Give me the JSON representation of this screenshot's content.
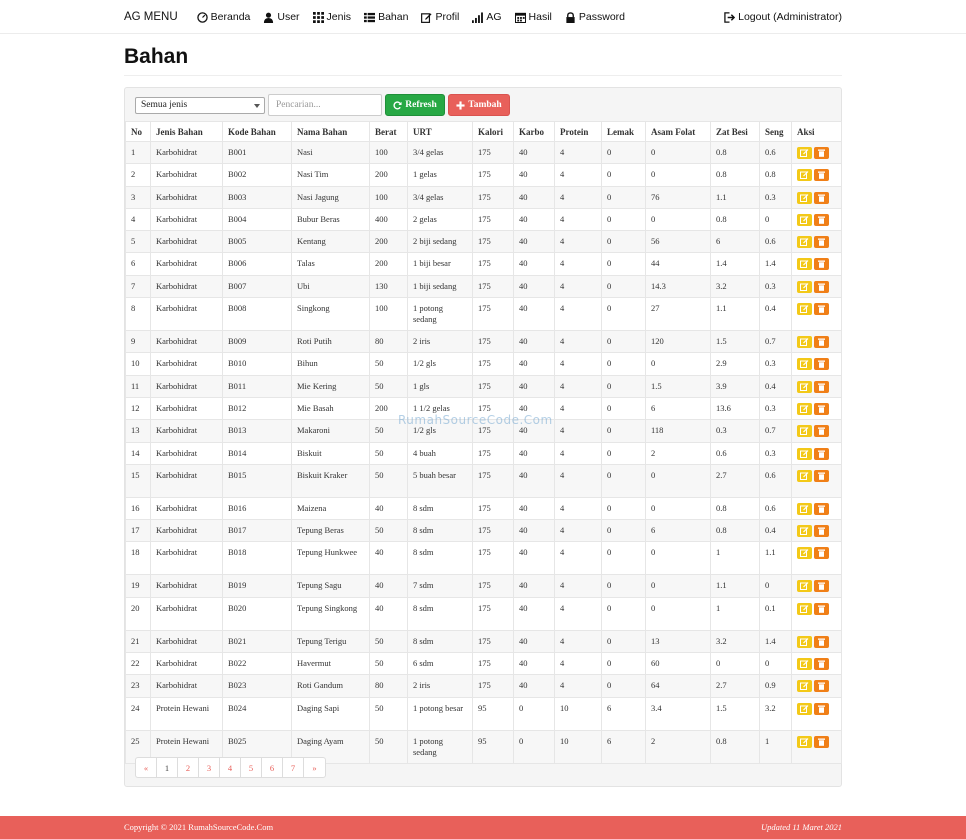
{
  "nav": {
    "brand": "AG MENU",
    "items": [
      {
        "label": "Beranda",
        "icon": "dashboard-icon"
      },
      {
        "label": "User",
        "icon": "user-icon"
      },
      {
        "label": "Jenis",
        "icon": "grid-icon"
      },
      {
        "label": "Bahan",
        "icon": "list-icon"
      },
      {
        "label": "Profil",
        "icon": "edit-icon"
      },
      {
        "label": "AG",
        "icon": "signal-icon"
      },
      {
        "label": "Hasil",
        "icon": "calendar-icon"
      },
      {
        "label": "Password",
        "icon": "lock-icon"
      }
    ],
    "logout": "Logout (Administrator)"
  },
  "page": {
    "title": "Bahan"
  },
  "toolbar": {
    "filter_value": "Semua jenis",
    "search_placeholder": "Pencarian...",
    "refresh_label": "Refresh",
    "add_label": "Tambah"
  },
  "table": {
    "headers": [
      "No",
      "Jenis Bahan",
      "Kode Bahan",
      "Nama Bahan",
      "Berat",
      "URT",
      "Kalori",
      "Karbo",
      "Protein",
      "Lemak",
      "Asam Folat",
      "Zat Besi",
      "Seng",
      "Aksi"
    ],
    "rows": [
      [
        "1",
        "Karbohidrat",
        "B001",
        "Nasi",
        "100",
        "3/4 gelas",
        "175",
        "40",
        "4",
        "0",
        "0",
        "0.8",
        "0.6"
      ],
      [
        "2",
        "Karbohidrat",
        "B002",
        "Nasi Tim",
        "200",
        "1 gelas",
        "175",
        "40",
        "4",
        "0",
        "0",
        "0.8",
        "0.8"
      ],
      [
        "3",
        "Karbohidrat",
        "B003",
        "Nasi Jagung",
        "100",
        "3/4 gelas",
        "175",
        "40",
        "4",
        "0",
        "76",
        "1.1",
        "0.3"
      ],
      [
        "4",
        "Karbohidrat",
        "B004",
        "Bubur Beras",
        "400",
        "2 gelas",
        "175",
        "40",
        "4",
        "0",
        "0",
        "0.8",
        "0"
      ],
      [
        "5",
        "Karbohidrat",
        "B005",
        "Kentang",
        "200",
        "2 biji sedang",
        "175",
        "40",
        "4",
        "0",
        "56",
        "6",
        "0.6"
      ],
      [
        "6",
        "Karbohidrat",
        "B006",
        "Talas",
        "200",
        "1 biji besar",
        "175",
        "40",
        "4",
        "0",
        "44",
        "1.4",
        "1.4"
      ],
      [
        "7",
        "Karbohidrat",
        "B007",
        "Ubi",
        "130",
        "1 biji sedang",
        "175",
        "40",
        "4",
        "0",
        "14.3",
        "3.2",
        "0.3"
      ],
      [
        "8",
        "Karbohidrat",
        "B008",
        "Singkong",
        "100",
        "1 potong sedang",
        "175",
        "40",
        "4",
        "0",
        "27",
        "1.1",
        "0.4"
      ],
      [
        "9",
        "Karbohidrat",
        "B009",
        "Roti Putih",
        "80",
        "2 iris",
        "175",
        "40",
        "4",
        "0",
        "120",
        "1.5",
        "0.7"
      ],
      [
        "10",
        "Karbohidrat",
        "B010",
        "Bihun",
        "50",
        "1/2 gls",
        "175",
        "40",
        "4",
        "0",
        "0",
        "2.9",
        "0.3"
      ],
      [
        "11",
        "Karbohidrat",
        "B011",
        "Mie Kering",
        "50",
        "1 gls",
        "175",
        "40",
        "4",
        "0",
        "1.5",
        "3.9",
        "0.4"
      ],
      [
        "12",
        "Karbohidrat",
        "B012",
        "Mie Basah",
        "200",
        "1 1/2 gelas",
        "175",
        "40",
        "4",
        "0",
        "6",
        "13.6",
        "0.3"
      ],
      [
        "13",
        "Karbohidrat",
        "B013",
        "Makaroni",
        "50",
        "1/2 gls",
        "175",
        "40",
        "4",
        "0",
        "118",
        "0.3",
        "0.7"
      ],
      [
        "14",
        "Karbohidrat",
        "B014",
        "Biskuit",
        "50",
        "4 buah",
        "175",
        "40",
        "4",
        "0",
        "2",
        "0.6",
        "0.3"
      ],
      [
        "15",
        "Karbohidrat",
        "B015",
        "Biskuit Kraker",
        "50",
        "5 buah besar",
        "175",
        "40",
        "4",
        "0",
        "0",
        "2.7",
        "0.6"
      ],
      [
        "16",
        "Karbohidrat",
        "B016",
        "Maizena",
        "40",
        "8 sdm",
        "175",
        "40",
        "4",
        "0",
        "0",
        "0.8",
        "0.6"
      ],
      [
        "17",
        "Karbohidrat",
        "B017",
        "Tepung Beras",
        "50",
        "8 sdm",
        "175",
        "40",
        "4",
        "0",
        "6",
        "0.8",
        "0.4"
      ],
      [
        "18",
        "Karbohidrat",
        "B018",
        "Tepung Hunkwee",
        "40",
        "8 sdm",
        "175",
        "40",
        "4",
        "0",
        "0",
        "1",
        "1.1"
      ],
      [
        "19",
        "Karbohidrat",
        "B019",
        "Tepung Sagu",
        "40",
        "7 sdm",
        "175",
        "40",
        "4",
        "0",
        "0",
        "1.1",
        "0"
      ],
      [
        "20",
        "Karbohidrat",
        "B020",
        "Tepung Singkong",
        "40",
        "8 sdm",
        "175",
        "40",
        "4",
        "0",
        "0",
        "1",
        "0.1"
      ],
      [
        "21",
        "Karbohidrat",
        "B021",
        "Tepung Terigu",
        "50",
        "8 sdm",
        "175",
        "40",
        "4",
        "0",
        "13",
        "3.2",
        "1.4"
      ],
      [
        "22",
        "Karbohidrat",
        "B022",
        "Havermut",
        "50",
        "6 sdm",
        "175",
        "40",
        "4",
        "0",
        "60",
        "0",
        "0"
      ],
      [
        "23",
        "Karbohidrat",
        "B023",
        "Roti Gandum",
        "80",
        "2 iris",
        "175",
        "40",
        "4",
        "0",
        "64",
        "2.7",
        "0.9"
      ],
      [
        "24",
        "Protein Hewani",
        "B024",
        "Daging Sapi",
        "50",
        "1 potong besar",
        "95",
        "0",
        "10",
        "6",
        "3.4",
        "1.5",
        "3.2"
      ],
      [
        "25",
        "Protein Hewani",
        "B025",
        "Daging Ayam",
        "50",
        "1 potong sedang",
        "95",
        "0",
        "10",
        "6",
        "2",
        "0.8",
        "1"
      ]
    ]
  },
  "pagination": [
    "«",
    "1",
    "2",
    "3",
    "4",
    "5",
    "6",
    "7",
    "»"
  ],
  "watermark": "RumahSourceCode.Com",
  "footer": {
    "copyright": "Copyright © 2021 RumahSourceCode.Com",
    "updated": "Updated 11 Maret 2021"
  },
  "colors": {
    "accent": "#e8605a",
    "success": "#27a844",
    "edit": "#f3c918",
    "delete": "#f07f17"
  }
}
